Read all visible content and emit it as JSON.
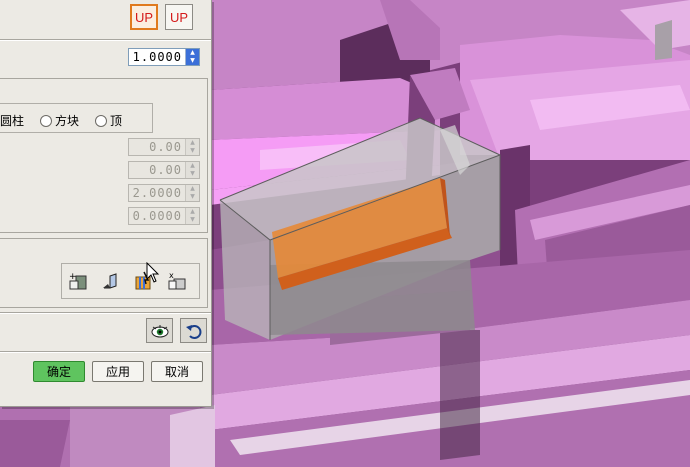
{
  "header": {
    "up_button_1": "UP",
    "up_button_2": "UP"
  },
  "scale": {
    "value": "1.0000"
  },
  "shape": {
    "options": [
      "圆柱",
      "方块",
      "顶"
    ]
  },
  "fields": [
    "0.00",
    "0.00",
    "2.0000",
    "0.0000"
  ],
  "tools": [
    "add-tool-icon",
    "boolean-tool-icon",
    "split-tool-icon",
    "remove-tool-icon"
  ],
  "icon_buttons": [
    "eye-icon",
    "undo-icon"
  ],
  "footer": {
    "ok": "确定",
    "apply": "应用",
    "cancel": "取消"
  },
  "colors": {
    "solid_magenta": "#d27fd2",
    "highlight_orange": "#e58a3a",
    "dialog_bg": "#eceae4",
    "ok_green": "#5fc45f"
  }
}
